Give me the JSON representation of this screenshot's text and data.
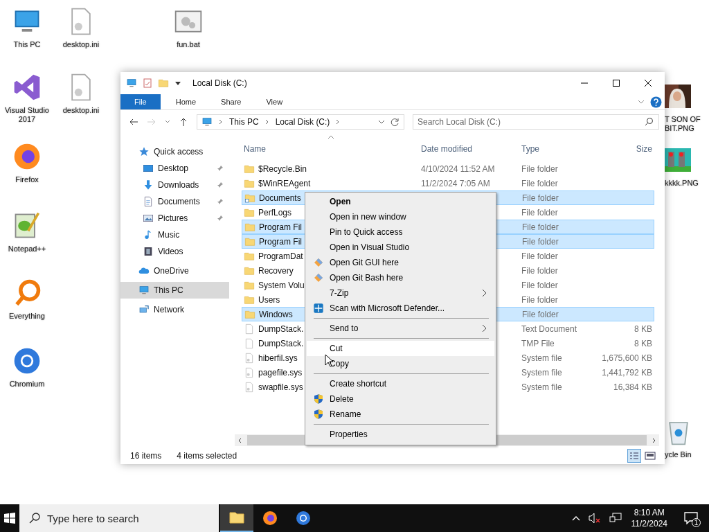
{
  "desktop_icons": [
    {
      "label": "This PC",
      "kind": "pc"
    },
    {
      "label": "desktop.ini",
      "kind": "ini"
    },
    {
      "label": "fun.bat",
      "kind": "bat"
    },
    {
      "label": "Visual Studio 2017",
      "kind": "vs"
    },
    {
      "label": "desktop.ini",
      "kind": "ini"
    },
    {
      "label": "Firefox",
      "kind": "firefox"
    },
    {
      "label": "Notepad++",
      "kind": "notepad"
    },
    {
      "label": "Everything",
      "kind": "everything"
    },
    {
      "label": "Chromium",
      "kind": "chromium"
    },
    {
      "label": "T SON OF BIT.PNG",
      "kind": "picture"
    },
    {
      "label": "kkkk.PNG",
      "kind": "picture"
    },
    {
      "label": "ycle Bin",
      "kind": "recycle"
    }
  ],
  "window": {
    "title": "Local Disk (C:)",
    "ribbon_tabs": [
      {
        "label": "File",
        "selected": true
      },
      {
        "label": "Home",
        "selected": false
      },
      {
        "label": "Share",
        "selected": false
      },
      {
        "label": "View",
        "selected": false
      }
    ],
    "address": [
      "This PC",
      "Local Disk (C:)"
    ],
    "search": {
      "placeholder": "Search Local Disk (C:)"
    },
    "nav": [
      {
        "label": "Quick access",
        "kind": "star",
        "selected": false,
        "children": [
          {
            "label": "Desktop",
            "kind": "desktop",
            "pinned": true,
            "selected": false
          },
          {
            "label": "Downloads",
            "kind": "download",
            "pinned": true,
            "selected": false
          },
          {
            "label": "Documents",
            "kind": "document",
            "pinned": true,
            "selected": false
          },
          {
            "label": "Pictures",
            "kind": "pictures",
            "pinned": true,
            "selected": false
          },
          {
            "label": "Music",
            "kind": "music",
            "pinned": false,
            "selected": false
          },
          {
            "label": "Videos",
            "kind": "video",
            "pinned": false,
            "selected": false
          }
        ]
      },
      {
        "label": "OneDrive",
        "kind": "cloud",
        "selected": false
      },
      {
        "label": "This PC",
        "kind": "pc",
        "selected": true
      },
      {
        "label": "Network",
        "kind": "network",
        "selected": false
      }
    ],
    "columns": [
      "Name",
      "Date modified",
      "Type",
      "Size"
    ],
    "rows": [
      {
        "name": "$Recycle.Bin",
        "date": "4/10/2024 11:52 AM",
        "type": "File folder",
        "kind": "folder",
        "selected": false
      },
      {
        "name": "$WinREAgent",
        "date": "11/2/2024 7:05 AM",
        "type": "File folder",
        "kind": "folder",
        "selected": false
      },
      {
        "name": "Documents",
        "type": "File folder",
        "kind": "link",
        "selected": true
      },
      {
        "name": "PerfLogs",
        "type": "File folder",
        "kind": "folder",
        "selected": false
      },
      {
        "name": "Program Fil",
        "type": "File folder",
        "kind": "folder",
        "selected": true
      },
      {
        "name": "Program Fil",
        "type": "File folder",
        "kind": "folder",
        "selected": true
      },
      {
        "name": "ProgramDat",
        "type": "File folder",
        "kind": "folder",
        "selected": false
      },
      {
        "name": "Recovery",
        "type": "File folder",
        "kind": "folder",
        "selected": false
      },
      {
        "name": "System Volu",
        "type": "File folder",
        "kind": "folder",
        "selected": false
      },
      {
        "name": "Users",
        "type": "File folder",
        "kind": "folder",
        "selected": false
      },
      {
        "name": "Windows",
        "type": "File folder",
        "kind": "folder",
        "selected": true
      },
      {
        "name": "DumpStack.",
        "type": "Text Document",
        "size": "8 KB",
        "kind": "file",
        "selected": false
      },
      {
        "name": "DumpStack.",
        "type": "TMP File",
        "size": "8 KB",
        "kind": "file",
        "selected": false
      },
      {
        "name": "hiberfil.sys",
        "type": "System file",
        "size": "1,675,600 KB",
        "kind": "sys",
        "selected": false
      },
      {
        "name": "pagefile.sys",
        "type": "System file",
        "size": "1,441,792 KB",
        "kind": "sys",
        "selected": false
      },
      {
        "name": "swapfile.sys",
        "type": "System file",
        "size": "16,384 KB",
        "kind": "sys",
        "selected": false
      }
    ],
    "status": {
      "count": "16 items",
      "selection": "4 items selected"
    }
  },
  "context_menu": [
    {
      "kind": "item",
      "label": "Open",
      "default": true,
      "selected": false
    },
    {
      "kind": "item",
      "label": "Open in new window",
      "selected": false
    },
    {
      "kind": "item",
      "label": "Pin to Quick access",
      "selected": false
    },
    {
      "kind": "item",
      "label": "Open in Visual Studio",
      "selected": false
    },
    {
      "kind": "item",
      "label": "Open Git GUI here",
      "selected": false
    },
    {
      "kind": "item",
      "label": "Open Git Bash here",
      "selected": false
    },
    {
      "kind": "submenu",
      "label": "7-Zip",
      "selected": false
    },
    {
      "kind": "item",
      "label": "Scan with Microsoft Defender...",
      "selected": false
    },
    {
      "kind": "separator"
    },
    {
      "kind": "submenu",
      "label": "Send to",
      "selected": false
    },
    {
      "kind": "separator"
    },
    {
      "kind": "item",
      "label": "Cut",
      "selected": true
    },
    {
      "kind": "item",
      "label": "Copy",
      "selected": false
    },
    {
      "kind": "separator"
    },
    {
      "kind": "item",
      "label": "Create shortcut",
      "selected": false
    },
    {
      "kind": "item",
      "label": "Delete",
      "selected": false
    },
    {
      "kind": "item",
      "label": "Rename",
      "selected": false
    },
    {
      "kind": "separator"
    },
    {
      "kind": "item",
      "label": "Properties",
      "selected": false
    }
  ],
  "taskbar": {
    "search_placeholder": "Type here to search",
    "apps": [
      {
        "kind": "explorer",
        "active": true
      },
      {
        "kind": "firefox",
        "active": false
      },
      {
        "kind": "chromium",
        "active": false
      }
    ],
    "time": "8:10 AM",
    "date": "11/2/2024",
    "notifications": "1"
  }
}
